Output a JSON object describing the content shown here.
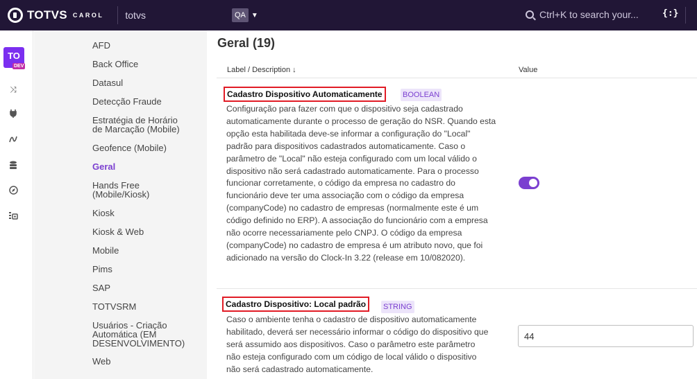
{
  "topbar": {
    "brand": "TOTVS",
    "brand_sub": "CAROL",
    "tenant": "totvs",
    "env_badge": "QA",
    "search_placeholder": "Ctrl+K to search your...",
    "json_icon": "{:}"
  },
  "rail": {
    "badge": "TO",
    "badge_sub": "DEV",
    "icons": [
      "shuffle-icon",
      "plug-icon",
      "pipeline-icon",
      "database-icon",
      "compass-icon",
      "grid-settings-icon"
    ]
  },
  "categories": [
    {
      "label": "AFD"
    },
    {
      "label": "Back Office"
    },
    {
      "label": "Datasul"
    },
    {
      "label": "Detecção Fraude"
    },
    {
      "label": "Estratégia de Horário de Marcação (Mobile)"
    },
    {
      "label": "Geofence (Mobile)"
    },
    {
      "label": "Geral",
      "active": true
    },
    {
      "label": "Hands Free (Mobile/Kiosk)"
    },
    {
      "label": "Kiosk"
    },
    {
      "label": "Kiosk & Web"
    },
    {
      "label": "Mobile"
    },
    {
      "label": "Pims"
    },
    {
      "label": "SAP"
    },
    {
      "label": "TOTVSRM"
    },
    {
      "label": "Usuários - Criação Automática (EM DESENVOLVIMENTO)"
    },
    {
      "label": "Web"
    }
  ],
  "main": {
    "title": "Geral (19)",
    "col_label": "Label / Description ↓",
    "col_value": "Value",
    "props": [
      {
        "title": "Cadastro Dispositivo Automaticamente",
        "type": "BOOLEAN",
        "description": "Configuração para fazer com que o dispositivo seja cadastrado automaticamente durante o processo de geração do NSR. Quando esta opção esta habilitada deve-se informar a configuração do \"Local\" padrão para dispositivos cadastrados automaticamente. Caso o parâmetro de \"Local\" não esteja configurado com um local válido o dispositivo não será cadastrado automaticamente. Para o processo funcionar corretamente, o código da empresa no cadastro do funcionário deve ter uma associação com o código da empresa (companyCode) no cadastro de empresas (normalmente este é um código definido no ERP). A associação do funcionário com a empresa não ocorre necessariamente pelo CNPJ. O código da empresa (companyCode) no cadastro de empresa é um atributo novo, que foi adicionado na versão do Clock-In 3.22 (release em 10/082020).",
        "value": true
      },
      {
        "title": "Cadastro Dispositivo: Local padrão",
        "type": "STRING",
        "description": "Caso o ambiente tenha o cadastro de dispositivo automaticamente habilitado, deverá ser necessário informar o código do dispositivo que será assumido aos dispositivos. Caso o parâmetro este parâmetro não esteja configurado com um código de local válido o dispositivo não será cadastrado automaticamente.",
        "value": "44"
      }
    ]
  }
}
